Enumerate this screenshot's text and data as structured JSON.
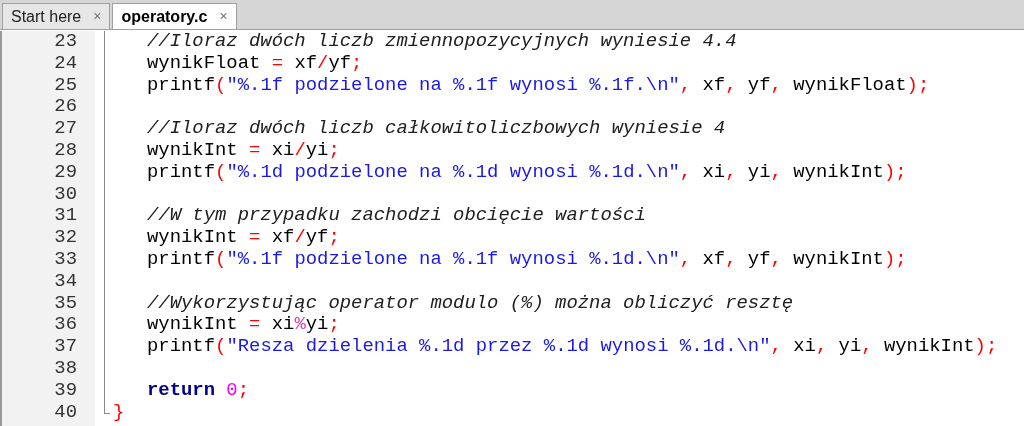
{
  "tabs": [
    {
      "label": "Start here",
      "close": "×",
      "selected": false
    },
    {
      "label": "operatory.c",
      "close": "×",
      "selected": true
    }
  ],
  "editor": {
    "lines": [
      {
        "number": "23",
        "indented": true,
        "tokens": [
          {
            "kind": "comment",
            "text": "//Iloraz dwóch liczb zmiennopozycyjnych wyniesie 4.4"
          }
        ]
      },
      {
        "number": "24",
        "indented": true,
        "tokens": [
          {
            "kind": "plain",
            "text": "wynikFloat "
          },
          {
            "kind": "op",
            "text": "="
          },
          {
            "kind": "plain",
            "text": " xf"
          },
          {
            "kind": "op",
            "text": "/"
          },
          {
            "kind": "plain",
            "text": "yf"
          },
          {
            "kind": "op",
            "text": ";"
          }
        ]
      },
      {
        "number": "25",
        "indented": true,
        "tokens": [
          {
            "kind": "plain",
            "text": "printf"
          },
          {
            "kind": "op",
            "text": "("
          },
          {
            "kind": "string",
            "text": "\"%.1f podzielone na %.1f wynosi %.1f.\\n\""
          },
          {
            "kind": "op",
            "text": ","
          },
          {
            "kind": "plain",
            "text": " xf"
          },
          {
            "kind": "op",
            "text": ","
          },
          {
            "kind": "plain",
            "text": " yf"
          },
          {
            "kind": "op",
            "text": ","
          },
          {
            "kind": "plain",
            "text": " wynikFloat"
          },
          {
            "kind": "op",
            "text": ");"
          }
        ]
      },
      {
        "number": "26",
        "indented": true
      },
      {
        "number": "27",
        "indented": true,
        "tokens": [
          {
            "kind": "comment",
            "text": "//Iloraz dwóch liczb całkowitoliczbowych wyniesie 4"
          }
        ]
      },
      {
        "number": "28",
        "indented": true,
        "tokens": [
          {
            "kind": "plain",
            "text": "wynikInt "
          },
          {
            "kind": "op",
            "text": "="
          },
          {
            "kind": "plain",
            "text": " xi"
          },
          {
            "kind": "op",
            "text": "/"
          },
          {
            "kind": "plain",
            "text": "yi"
          },
          {
            "kind": "op",
            "text": ";"
          }
        ]
      },
      {
        "number": "29",
        "indented": true,
        "tokens": [
          {
            "kind": "plain",
            "text": "printf"
          },
          {
            "kind": "op",
            "text": "("
          },
          {
            "kind": "string",
            "text": "\"%.1d podzielone na %.1d wynosi %.1d.\\n\""
          },
          {
            "kind": "op",
            "text": ","
          },
          {
            "kind": "plain",
            "text": " xi"
          },
          {
            "kind": "op",
            "text": ","
          },
          {
            "kind": "plain",
            "text": " yi"
          },
          {
            "kind": "op",
            "text": ","
          },
          {
            "kind": "plain",
            "text": " wynikInt"
          },
          {
            "kind": "op",
            "text": ");"
          }
        ]
      },
      {
        "number": "30",
        "indented": true
      },
      {
        "number": "31",
        "indented": true,
        "tokens": [
          {
            "kind": "comment",
            "text": "//W tym przypadku zachodzi obcięcie wartości"
          }
        ]
      },
      {
        "number": "32",
        "indented": true,
        "tokens": [
          {
            "kind": "plain",
            "text": "wynikInt "
          },
          {
            "kind": "op",
            "text": "="
          },
          {
            "kind": "plain",
            "text": " xf"
          },
          {
            "kind": "op",
            "text": "/"
          },
          {
            "kind": "plain",
            "text": "yf"
          },
          {
            "kind": "op",
            "text": ";"
          }
        ]
      },
      {
        "number": "33",
        "indented": true,
        "tokens": [
          {
            "kind": "plain",
            "text": "printf"
          },
          {
            "kind": "op",
            "text": "("
          },
          {
            "kind": "string",
            "text": "\"%.1f podzielone na %.1f wynosi %.1d.\\n\""
          },
          {
            "kind": "op",
            "text": ","
          },
          {
            "kind": "plain",
            "text": " xf"
          },
          {
            "kind": "op",
            "text": ","
          },
          {
            "kind": "plain",
            "text": " yf"
          },
          {
            "kind": "op",
            "text": ","
          },
          {
            "kind": "plain",
            "text": " wynikInt"
          },
          {
            "kind": "op",
            "text": ");"
          }
        ]
      },
      {
        "number": "34",
        "indented": true
      },
      {
        "number": "35",
        "indented": true,
        "tokens": [
          {
            "kind": "comment",
            "text": "//Wykorzystując operator modulo (%) można obliczyć resztę"
          }
        ]
      },
      {
        "number": "36",
        "indented": true,
        "tokens": [
          {
            "kind": "plain",
            "text": "wynikInt "
          },
          {
            "kind": "op",
            "text": "="
          },
          {
            "kind": "plain",
            "text": " xi"
          },
          {
            "kind": "percent",
            "text": "%"
          },
          {
            "kind": "plain",
            "text": "yi"
          },
          {
            "kind": "op",
            "text": ";"
          }
        ]
      },
      {
        "number": "37",
        "indented": true,
        "tokens": [
          {
            "kind": "plain",
            "text": "printf"
          },
          {
            "kind": "op",
            "text": "("
          },
          {
            "kind": "string",
            "text": "\"Resza dzielenia %.1d przez %.1d wynosi %.1d.\\n\""
          },
          {
            "kind": "op",
            "text": ","
          },
          {
            "kind": "plain",
            "text": " xi"
          },
          {
            "kind": "op",
            "text": ","
          },
          {
            "kind": "plain",
            "text": " yi"
          },
          {
            "kind": "op",
            "text": ","
          },
          {
            "kind": "plain",
            "text": " wynikInt"
          },
          {
            "kind": "op",
            "text": ");"
          }
        ]
      },
      {
        "number": "38",
        "indented": true
      },
      {
        "number": "39",
        "indented": true,
        "tokens": [
          {
            "kind": "keyword",
            "text": "return "
          },
          {
            "kind": "number",
            "text": "0"
          },
          {
            "kind": "op",
            "text": ";"
          }
        ]
      },
      {
        "number": "40",
        "indented": false,
        "tokens": [
          {
            "kind": "op",
            "text": "}"
          }
        ]
      }
    ]
  }
}
